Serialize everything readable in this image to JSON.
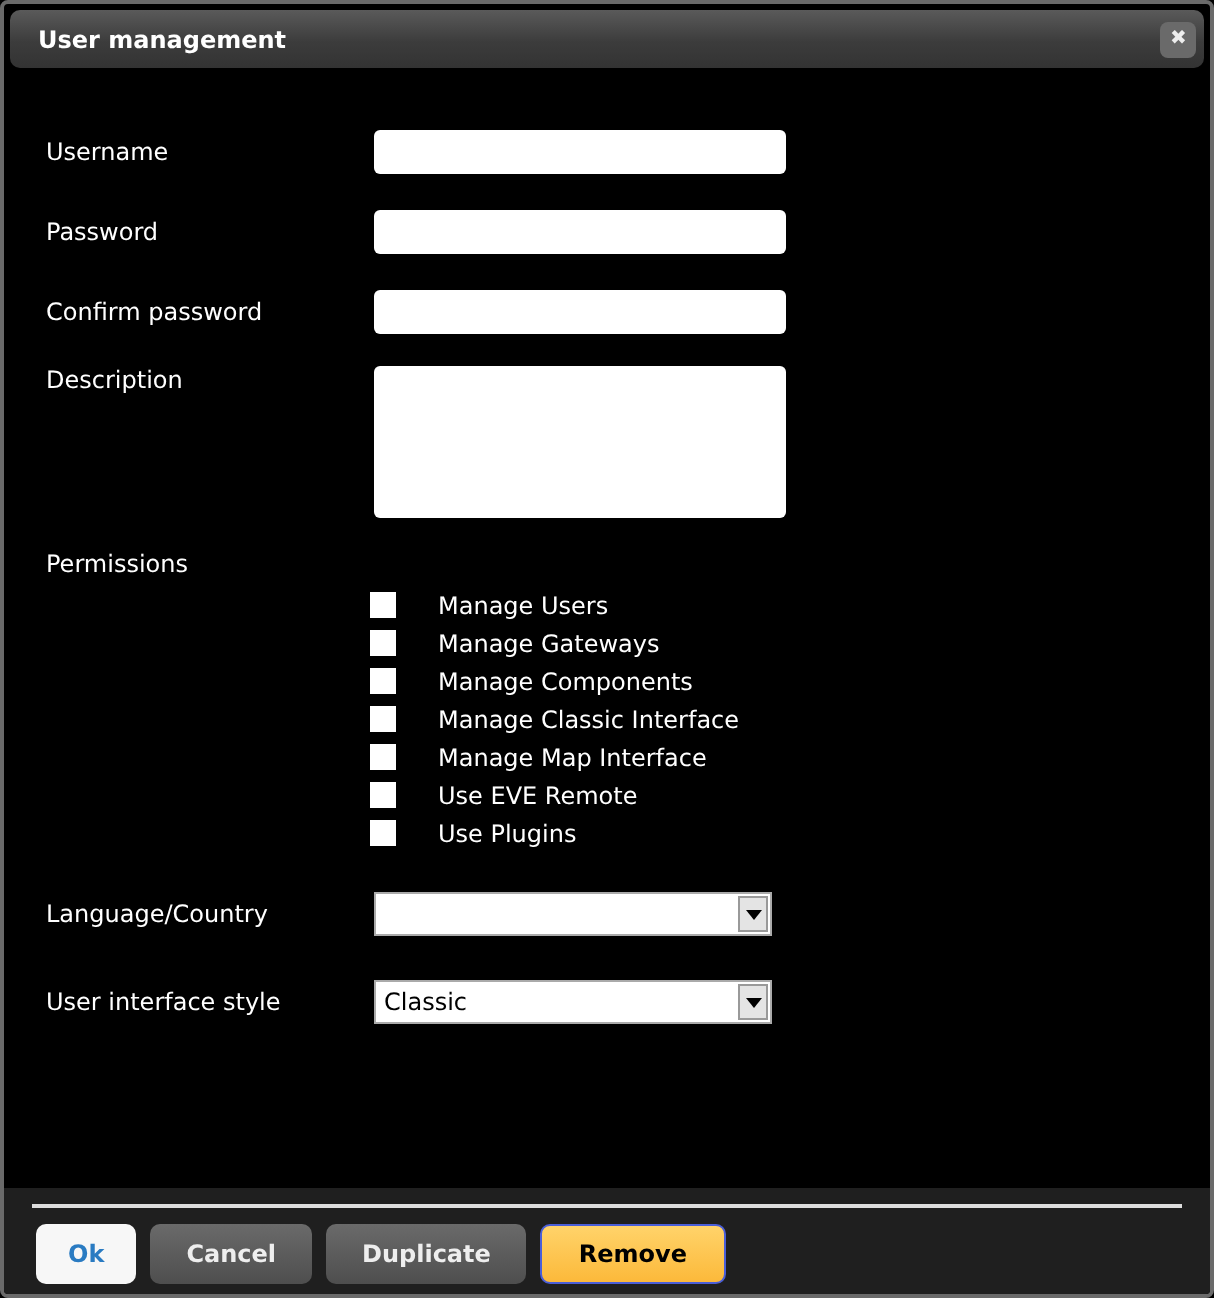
{
  "window": {
    "title": "User management",
    "close": "✖"
  },
  "fields": [
    {
      "label": "Username",
      "kind": "text"
    },
    {
      "label": "Password",
      "kind": "text"
    },
    {
      "label": "Confirm password",
      "kind": "text"
    },
    {
      "label": "Description",
      "kind": "textarea"
    }
  ],
  "permissions": {
    "label": "Permissions",
    "items": [
      {
        "label": "Manage Users",
        "checked": false
      },
      {
        "label": "Manage Gateways",
        "checked": false
      },
      {
        "label": "Manage Components",
        "checked": false
      },
      {
        "label": "Manage Classic Interface",
        "checked": false
      },
      {
        "label": "Manage Map Interface",
        "checked": false
      },
      {
        "label": "Use EVE Remote",
        "checked": false
      },
      {
        "label": "Use Plugins",
        "checked": false
      }
    ]
  },
  "selects": [
    {
      "label": "Language/Country"
    },
    {
      "label": "User interface style",
      "value": "Classic"
    }
  ],
  "buttons": [
    {
      "label": "Ok",
      "kind": "primary"
    },
    {
      "label": "Cancel",
      "kind": "normal"
    },
    {
      "label": "Duplicate",
      "kind": "normal"
    },
    {
      "label": "Remove",
      "kind": "warning"
    }
  ]
}
